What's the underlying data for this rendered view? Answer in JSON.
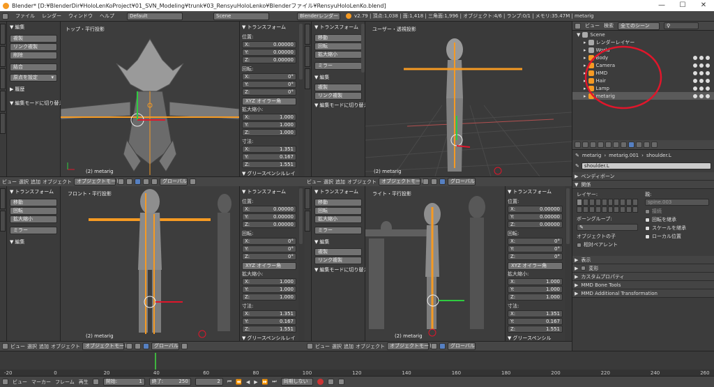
{
  "titlebar": {
    "text": "Blender* [D:¥BlenderDir¥HoloLenKoProject¥01_SVN_Modeling¥trunk¥03_RensyuHoloLenko¥Blenderファイル¥RensyuHoloLenKo.blend]",
    "minimize": "—",
    "maximize": "☐",
    "close": "✕"
  },
  "info": {
    "menu": [
      "ファイル",
      "レンダー",
      "ウィンドウ",
      "ヘルプ"
    ],
    "layout": "Default",
    "scene": "Scene",
    "engine": "Blenderレンダー",
    "stats": "v2.79 | 頂点:1,038 | 面:1,418 | 三角面:1,996 | オブジェクト:4/6 | ランプ:0/1 | メモリ:35.47M | metarig"
  },
  "toolshelf": {
    "edit_header": "編集",
    "buttons": [
      "複製",
      "リンク複製",
      "削除"
    ],
    "buttons2": [
      "結合"
    ],
    "origin": "原点を設定",
    "history": "履歴",
    "transform_header": "トランスフォーム",
    "t_buttons": [
      "移動",
      "回転",
      "拡大縮小"
    ],
    "mirror": "ミラー",
    "edit_mode_switch": "編集モードに切り替え"
  },
  "npanel": {
    "transform": "トランスフォーム",
    "location": "位置:",
    "loc": [
      {
        "axis": "X:",
        "val": "0.00000"
      },
      {
        "axis": "Y:",
        "val": "0.00000"
      },
      {
        "axis": "Z:",
        "val": "0.00000"
      }
    ],
    "rotation": "回転:",
    "rot": [
      {
        "axis": "X:",
        "val": "0°"
      },
      {
        "axis": "Y:",
        "val": "0°"
      },
      {
        "axis": "Z:",
        "val": "0°"
      }
    ],
    "rot_mode": "XYZ オイラー角",
    "scale": "拡大縮小:",
    "scl": [
      {
        "axis": "X:",
        "val": "1.000"
      },
      {
        "axis": "Y:",
        "val": "1.000"
      },
      {
        "axis": "Z:",
        "val": "1.000"
      }
    ],
    "dims": "寸法:",
    "dim": [
      {
        "axis": "X:",
        "val": "1.351"
      },
      {
        "axis": "Y:",
        "val": "0.167"
      },
      {
        "axis": "Z:",
        "val": "1.551"
      }
    ],
    "grease": "グリースペンシルレイ",
    "grease2": "グリースペンシル"
  },
  "viewports": {
    "top": "トップ・平行投影",
    "user": "ユーザー・透視投影",
    "front": "フロント・平行投影",
    "right": "ライト・平行投影",
    "obj": "(2) metarig"
  },
  "hdr3d": {
    "view": "ビュー",
    "select": "選択",
    "add": "追加",
    "object": "オブジェクト",
    "mode": "オブジェクトモード",
    "global": "グローバル"
  },
  "outliner": {
    "view": "ビュー",
    "search": "検索",
    "filter": "全てのシーン",
    "items": [
      {
        "name": "Scene",
        "indent": 0
      },
      {
        "name": "レンダーレイヤー",
        "indent": 1
      },
      {
        "name": "World",
        "indent": 1
      },
      {
        "name": "Body",
        "indent": 1
      },
      {
        "name": "Camera",
        "indent": 1
      },
      {
        "name": "HMD",
        "indent": 1
      },
      {
        "name": "Hair",
        "indent": 1
      },
      {
        "name": "Lamp",
        "indent": 1
      },
      {
        "name": "metarig",
        "indent": 1
      }
    ],
    "circle_color": "#e0162b"
  },
  "props": {
    "breadcrumb": [
      "metarig",
      "metarig.001",
      "shoulder.L"
    ],
    "bone_name": "shoulder.L",
    "sections": {
      "bendy": "ベンディボーン",
      "relations": "関係",
      "display": "表示",
      "deform": "変形",
      "custom": "カスタムプロパティ",
      "mmd": "MMD Bone Tools",
      "mmd2": "MMD Additional Transformation"
    },
    "layer": "レイヤー:",
    "parent_label": "親:",
    "parent_val": "spine.003",
    "connect": "接続",
    "bone_group": "ボーングループ:",
    "obj_child": "オブジェクトの子",
    "relative_parent": "相対ペアレント",
    "inherit_rot": "回転を継承",
    "inherit_scale": "スケールを継承",
    "local_loc": "ローカル位置"
  },
  "timeline": {
    "view": "ビュー",
    "marker": "マーカー",
    "frame": "フレーム",
    "play": "再生",
    "start_label": "開始:",
    "start": "1",
    "end_label": "終了:",
    "end": "250",
    "current": "2",
    "sync": "同期しない",
    "ticks": [
      "-20",
      "0",
      "20",
      "40",
      "60",
      "80",
      "100",
      "120",
      "140",
      "160",
      "180",
      "200",
      "220",
      "240",
      "260"
    ]
  },
  "colors": {
    "accent": "#f59a23",
    "select": "#5680c2",
    "bone": "#e8a040"
  }
}
